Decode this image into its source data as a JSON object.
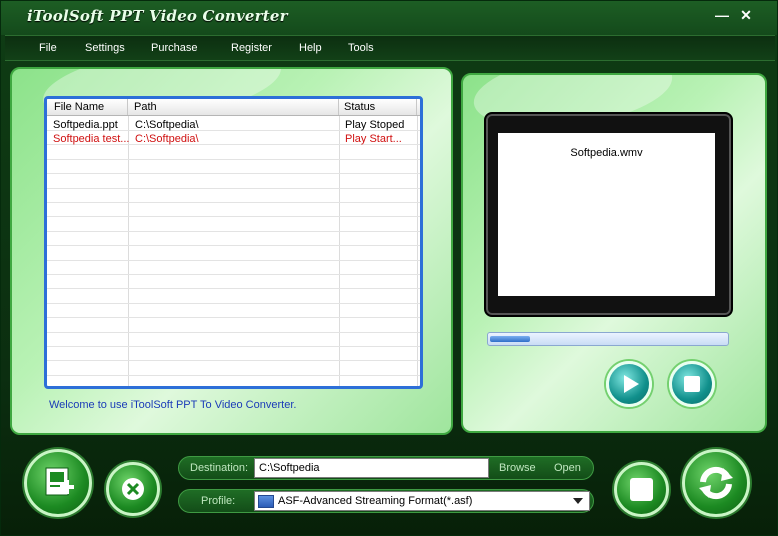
{
  "window": {
    "title": "iToolSoft PPT Video Converter",
    "minimize": "—",
    "close": "✕"
  },
  "menu": {
    "items": [
      "File",
      "Settings",
      "Purchase",
      "Register",
      "Help",
      "Tools"
    ]
  },
  "file_list": {
    "columns": [
      "File Name",
      "Path",
      "Status"
    ],
    "rows": [
      {
        "name": "Softpedia.ppt",
        "path": "C:\\Softpedia\\",
        "status": "Play Stoped",
        "state": "normal"
      },
      {
        "name": "Softpedia test...",
        "path": "C:\\Softpedia\\",
        "status": "Play Start...",
        "state": "active"
      }
    ]
  },
  "welcome": "Welcome to use iToolSoft PPT To Video Converter.",
  "preview": {
    "filename": "Softpedia.wmv",
    "progress": 0.17
  },
  "destination": {
    "label": "Destination:",
    "value": "C:\\Softpedia",
    "browse": "Browse",
    "open": "Open"
  },
  "profile": {
    "label": "Profile:",
    "selected": "ASF-Advanced Streaming Format(*.asf)"
  },
  "colors": {
    "accent_green": "#1c8a22",
    "panel_green": "#b9f2b5",
    "list_border": "#2d6fd8",
    "active_row_text": "#d01010",
    "welcome_text": "#1a3bb8"
  }
}
